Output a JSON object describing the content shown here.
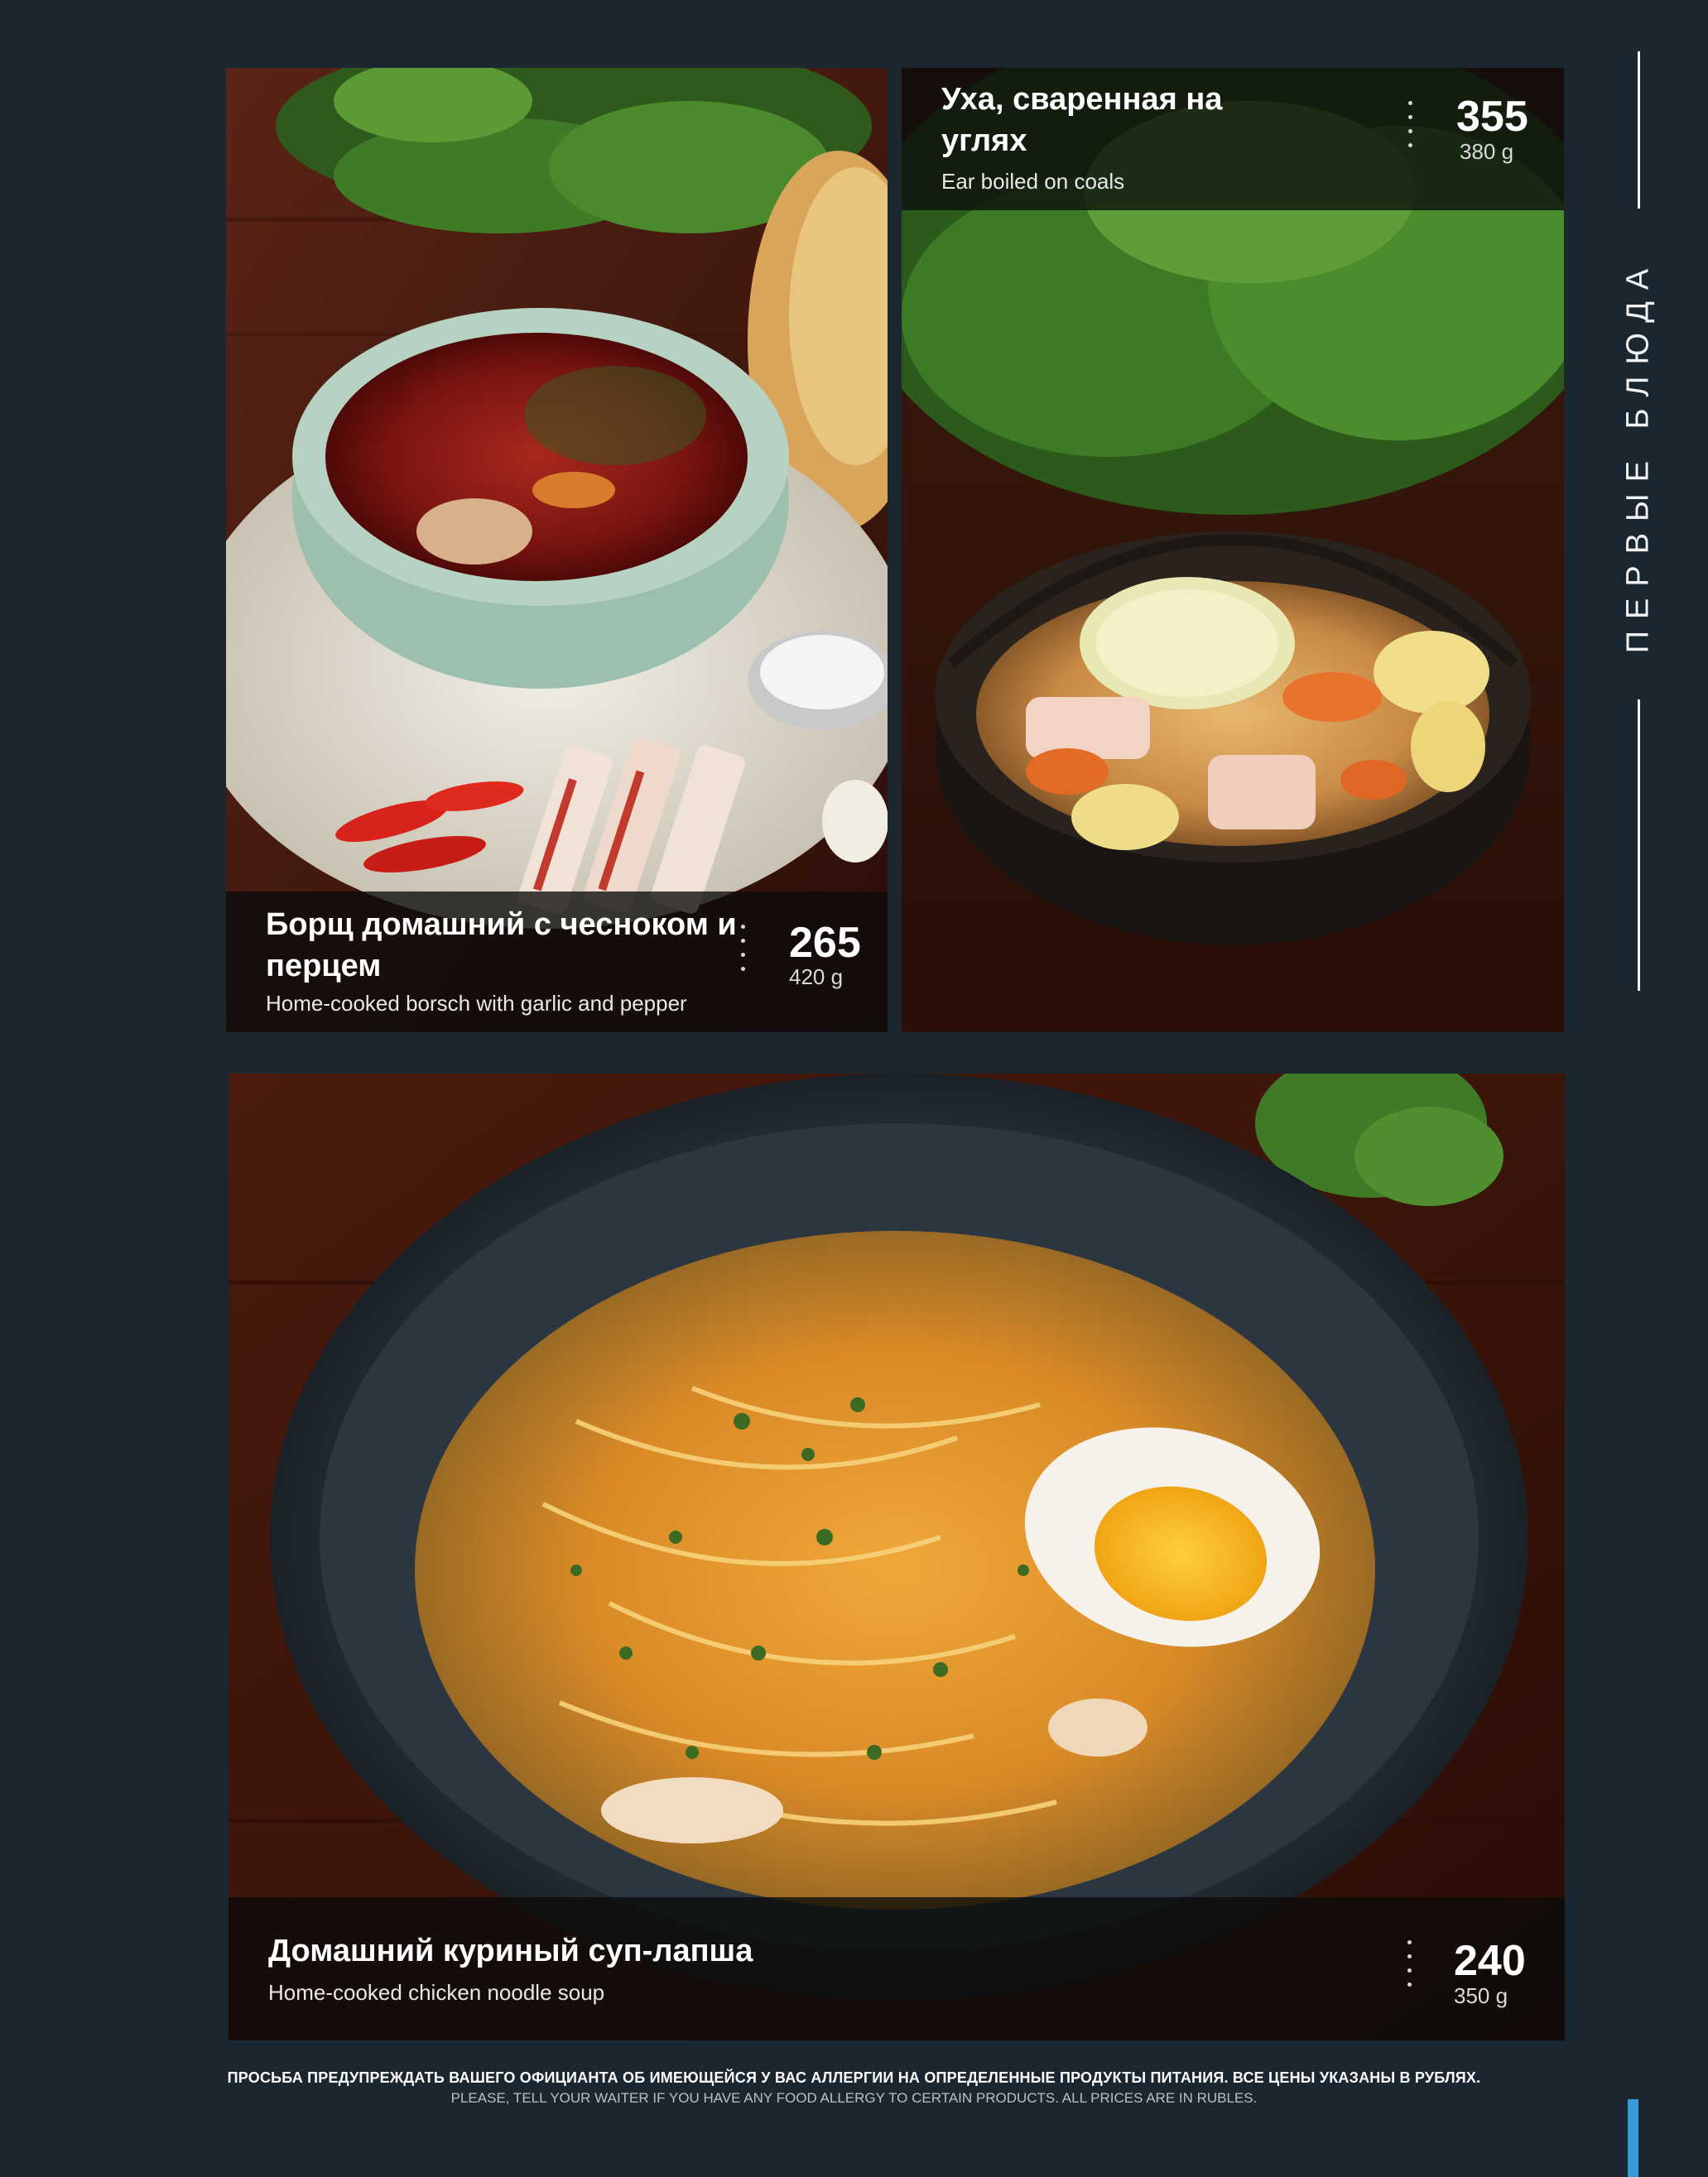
{
  "section_title": "ПЕРВЫЕ БЛЮДА",
  "dishes": [
    {
      "name_ru": "Борщ домашний с чесноком и перцем",
      "name_en": "Home-cooked borsch with garlic and pepper",
      "price": "265",
      "weight": "420 g"
    },
    {
      "name_ru": "Уха, сваренная на углях",
      "name_en": "Ear boiled on coals",
      "price": "355",
      "weight": "380 g"
    },
    {
      "name_ru": "Домашний куриный суп-лапша",
      "name_en": "Home-cooked chicken noodle soup",
      "price": "240",
      "weight": "350 g"
    }
  ],
  "footer": {
    "ru": "ПРОСЬБА ПРЕДУПРЕЖДАТЬ ВАШЕГО ОФИЦИАНТА ОБ ИМЕЮЩЕЙСЯ У ВАС АЛЛЕРГИИ НА ОПРЕДЕЛЕННЫЕ ПРОДУКТЫ ПИТАНИЯ. ВСЕ ЦЕНЫ УКАЗАНЫ В РУБЛЯХ.",
    "en": "PLEASE, TELL YOUR WAITER IF YOU HAVE ANY FOOD ALLERGY TO CERTAIN PRODUCTS. ALL PRICES ARE IN RUBLES."
  },
  "colors": {
    "page_background": "#1b2730",
    "accent": "#3a9ad8",
    "caption_overlay": "#0c0c0a"
  }
}
